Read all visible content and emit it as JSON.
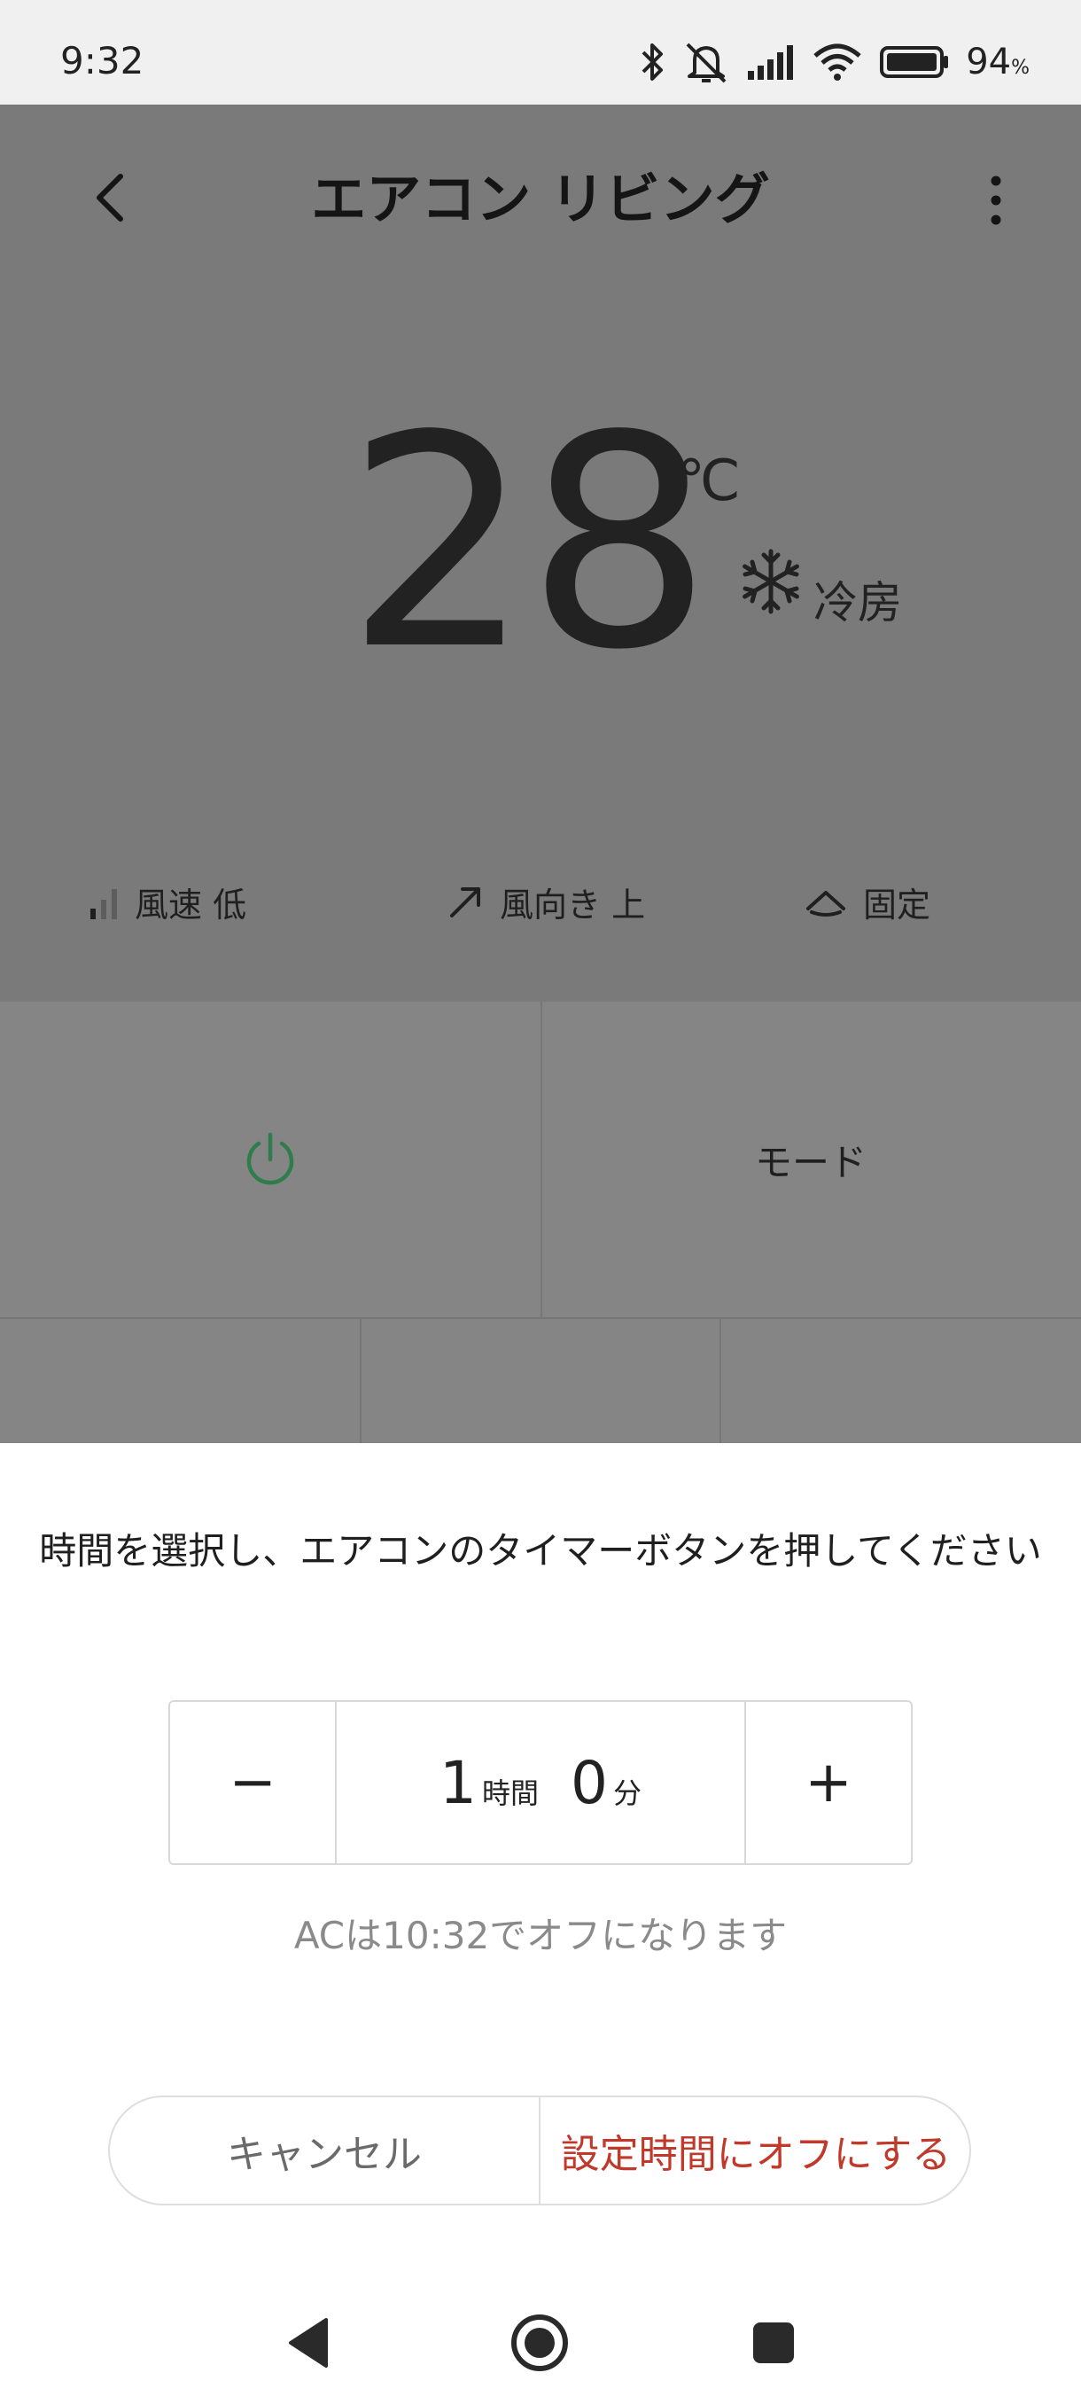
{
  "status_bar": {
    "time": "9:32",
    "battery_percent": "94",
    "battery_symbol": "%",
    "icons": [
      "bluetooth-icon",
      "mute-bell-icon",
      "signal-icon",
      "wifi-icon",
      "battery-icon"
    ]
  },
  "header": {
    "title": "エアコン リビング",
    "back_icon": "chevron-left-icon",
    "menu_icon": "more-vertical-icon"
  },
  "climate": {
    "temperature": "28",
    "unit": "℃",
    "mode_icon": "snowflake-icon",
    "mode": "冷房"
  },
  "settings_chips": [
    {
      "icon": "fan-speed-icon",
      "label": "風速 低"
    },
    {
      "icon": "swing-direction-icon",
      "label": "風向き 上"
    },
    {
      "icon": "louver-fixed-icon",
      "label": "固定"
    }
  ],
  "controls": {
    "power_icon": "power-icon",
    "power_color": "#2e7d4a",
    "mode_button": "モード"
  },
  "timer_sheet": {
    "message": "時間を選択し、エアコンのタイマーボタンを押してください",
    "minus": "−",
    "plus": "+",
    "hours": "1",
    "hours_unit": "時間",
    "minutes": "0",
    "minutes_unit": "分",
    "off_note": "ACは10:32でオフになります",
    "cancel": "キャンセル",
    "confirm": "設定時間にオフにする",
    "confirm_color": "#c0392b"
  },
  "nav_bar": {
    "buttons": [
      "nav-back-icon",
      "nav-home-icon",
      "nav-recents-icon"
    ]
  }
}
